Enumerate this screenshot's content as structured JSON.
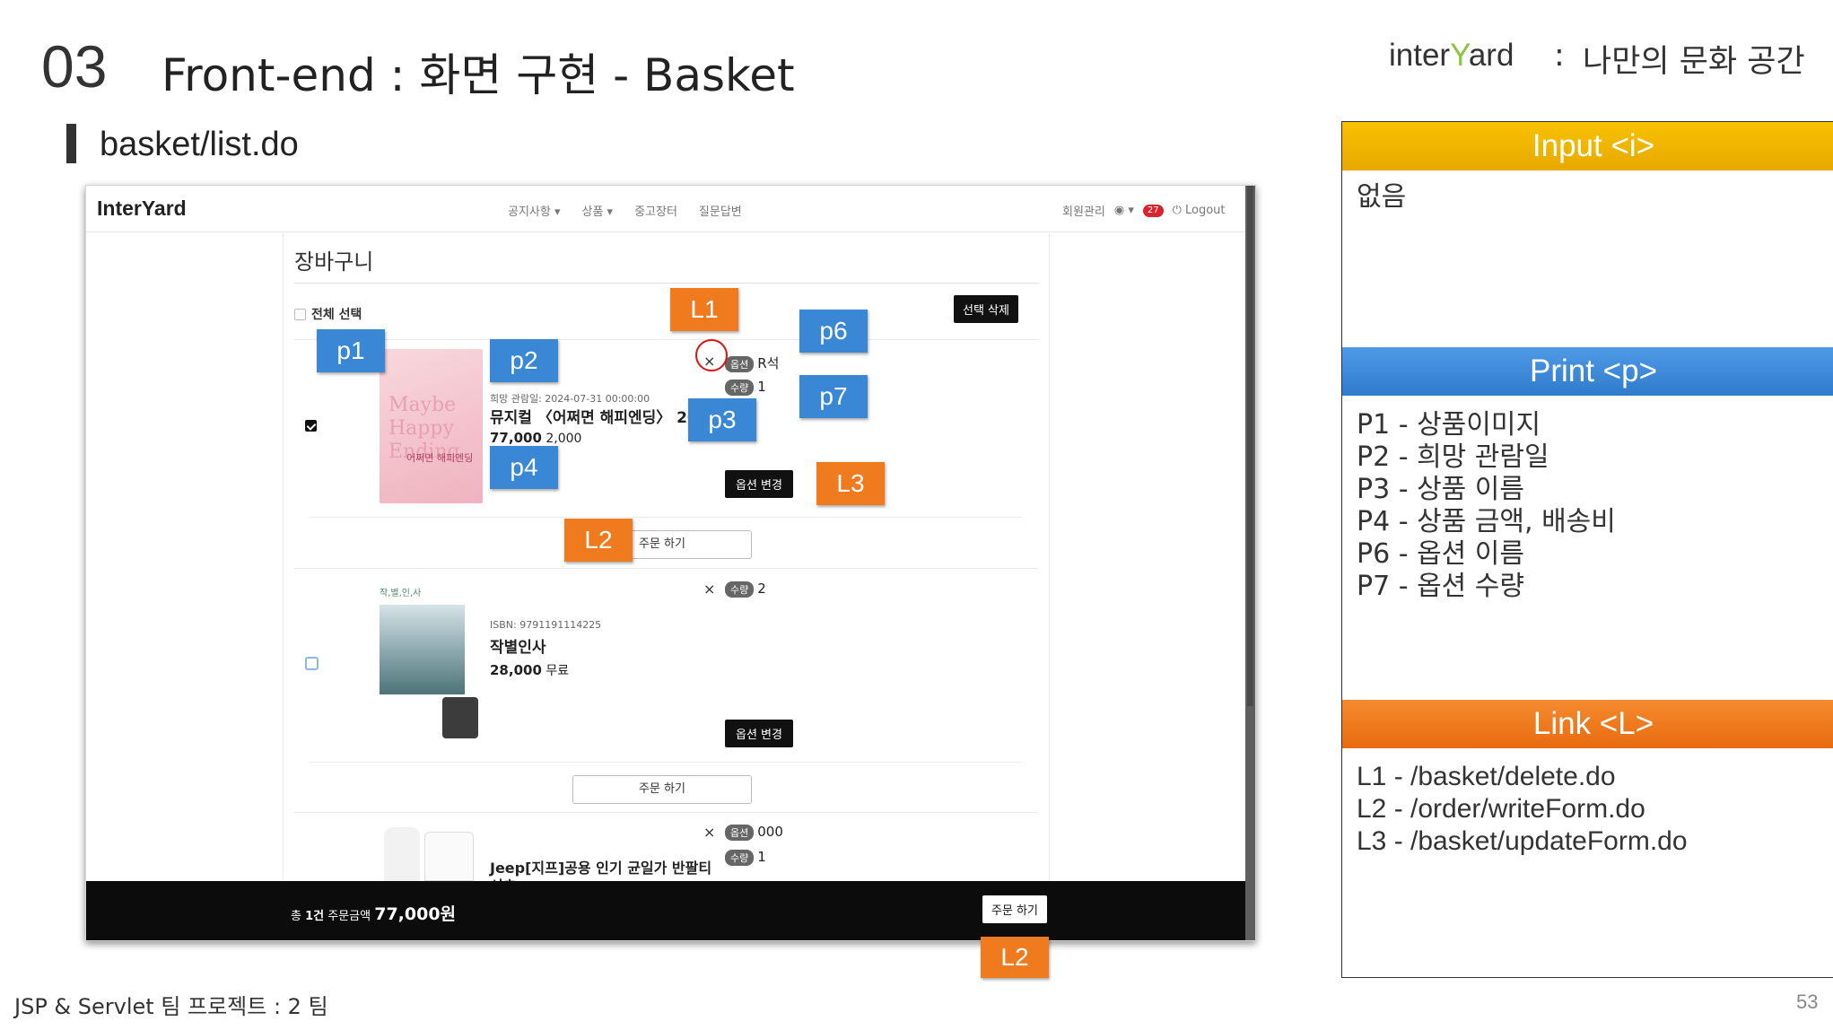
{
  "slide": {
    "number": "03",
    "title": "Front-end : 화면 구현 - Basket",
    "brand_prefix": "inter",
    "brand_y": "Y",
    "brand_suffix": "ard",
    "brand_separator": ":",
    "brand_tagline": "나만의 문화 공간",
    "section": "basket/list.do",
    "footer": "JSP & Servlet 팀 프로젝트 : 2 팀",
    "page_number": "53"
  },
  "screenshot": {
    "brand": "InterYard",
    "nav": [
      "공지사항 ▾",
      "상품 ▾",
      "중고장터",
      "질문답변"
    ],
    "nav_right": {
      "admin": "회원관리",
      "user": "◉ ▾",
      "badge": "27",
      "logout": "⏻ Logout"
    },
    "page_title": "장바구니",
    "select_all": "전체 선택",
    "delete_selected": "선택 삭제",
    "items": [
      {
        "meta": "희망 관람일: 2024-07-31 00:00:00",
        "name": "뮤지컬 〈어쩌면 해피엔딩〉 2024",
        "price": "77,000",
        "shipping": "2,000",
        "option_tag": "옵션",
        "option_value": "R석",
        "qty_tag": "수량",
        "qty_value": "1",
        "option_button": "옵션 변경",
        "order_button": "주문 하기",
        "poster_text": "Maybe Happy Ending",
        "poster_caption": "어쩌면 해피엔딩"
      },
      {
        "meta": "ISBN: 9791191114225",
        "name": "작별인사",
        "price": "28,000",
        "shipping": "무료",
        "qty_tag": "수량",
        "qty_value": "2",
        "option_button": "옵션 변경",
        "order_button": "주문 하기",
        "book_label": "작,별,인,사"
      },
      {
        "name": "Jeep[지프]공용 인기 균일가 반팔티",
        "name_cont": "셔츠",
        "option_tag": "옵션",
        "option_value": "000",
        "qty_tag": "수량",
        "qty_value": "1"
      }
    ],
    "close_symbol": "×",
    "total_prefix": "총 ",
    "total_count": "1건",
    "total_label": " 주문금액 ",
    "total_amount": "77,000원",
    "bottom_order": "주문 하기"
  },
  "annotations": {
    "p1": "p1",
    "p2": "p2",
    "p3": "p3",
    "p4": "p4",
    "p6": "p6",
    "p7": "p7",
    "l1": "L1",
    "l2": "L2",
    "l3": "L3",
    "l2b": "L2"
  },
  "panel": {
    "input_header": "Input <i>",
    "input_body": "없음",
    "print_header": "Print <p>",
    "print_lines": [
      "P1 - 상품이미지",
      "P2 - 희망 관람일",
      "P3 - 상품 이름",
      "P4 - 상품 금액, 배송비",
      "P6 - 옵션 이름",
      "P7 - 옵션 수량"
    ],
    "link_header": "Link <L>",
    "link_lines": [
      "L1 - /basket/delete.do",
      "L2 - /order/writeForm.do",
      "L3 - /basket/updateForm.do"
    ]
  },
  "colors": {
    "annotation_blue": "#3a87d6",
    "annotation_orange": "#f07a1e",
    "input_header": "#f7c200",
    "print_header": "#2f7bcc",
    "link_header": "#e86b10",
    "brand_accent": "#8bc53f"
  }
}
